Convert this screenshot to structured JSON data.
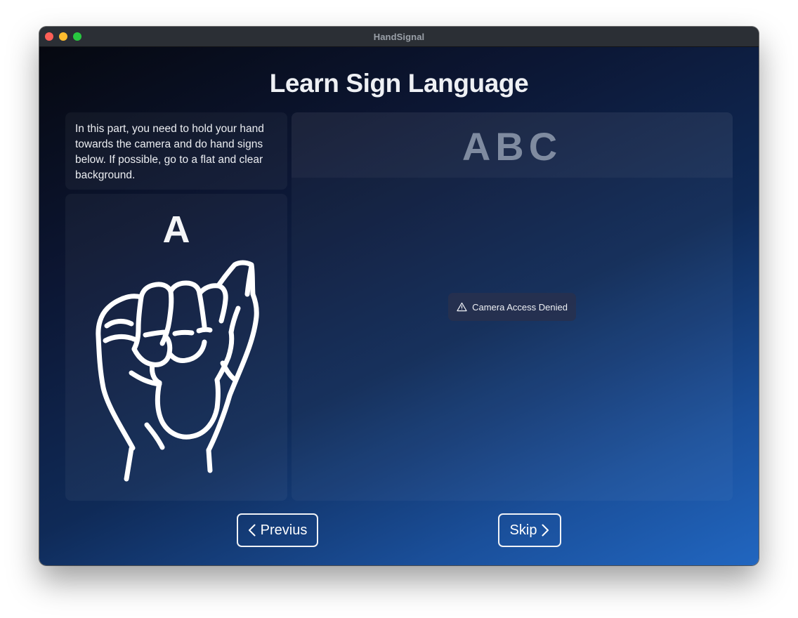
{
  "window": {
    "title": "HandSignal"
  },
  "page": {
    "title": "Learn Sign Language"
  },
  "instructions": {
    "text": "In this part, you need to hold your hand towards the camera and do hand signs below. If possible, go to a flat and clear background."
  },
  "sign_card": {
    "letter": "A",
    "illustration_icon": "asl-letter-a-hand-icon"
  },
  "camera_panel": {
    "alphabet_label": "ABC",
    "status_icon": "warning-triangle-icon",
    "status_text": "Camera Access Denied"
  },
  "navigation": {
    "previous_label": "Previus",
    "previous_icon": "chevron-left-icon",
    "skip_label": "Skip",
    "skip_icon": "chevron-right-icon"
  },
  "colors": {
    "background_start": "#05070d",
    "background_end": "#2166c0",
    "close": "#fe5f57",
    "minimize": "#febc2e",
    "maximize": "#28c840"
  }
}
